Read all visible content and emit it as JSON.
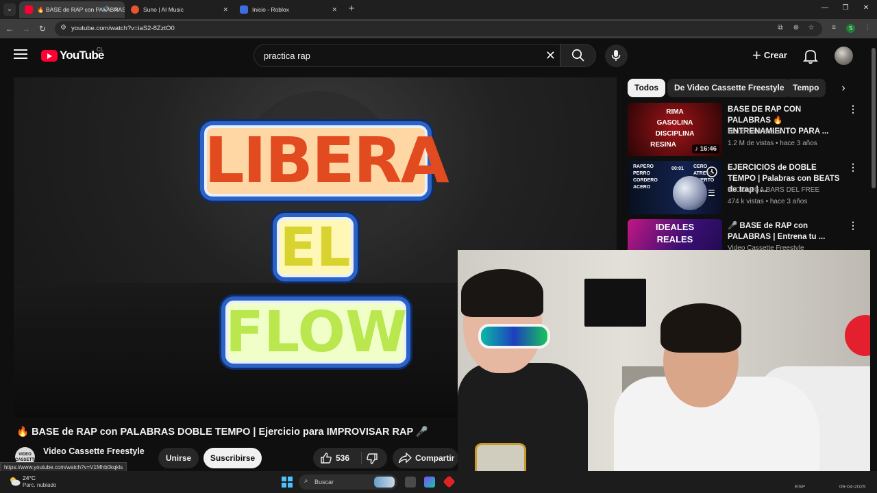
{
  "browser": {
    "tabs": [
      {
        "title": "🔥 BASE de RAP con PALABRAS",
        "active": true,
        "audio": true,
        "icon": "youtube-favicon"
      },
      {
        "title": "Suno | AI Music",
        "active": false,
        "icon": "suno-favicon"
      },
      {
        "title": "Inicio - Roblox",
        "active": false,
        "icon": "roblox-favicon"
      }
    ],
    "url": "youtube.com/watch?v=iaS2-8ZztO0",
    "profile_initial": "S",
    "status_url": "https://www.youtube.com/watch?v=V1Mhb0kqkls"
  },
  "youtube": {
    "logo_text": "YouTube",
    "country_code": "CL",
    "search_value": "practica rap",
    "create_label": "Crear"
  },
  "video": {
    "thumbnail_words": [
      "LIBERA",
      "EL",
      "FLOW"
    ],
    "title": "🔥 BASE de RAP con PALABRAS DOBLE TEMPO | Ejercicio para IMPROVISAR RAP 🎤",
    "channel": "Video Cassette Freestyle",
    "channel_avatar_text": "VIDEO CASSETTE",
    "join_label": "Unirse",
    "subscribe_label": "Suscribirse",
    "likes": "536",
    "share_label": "Compartir"
  },
  "chips": [
    "Todos",
    "De Video Cassette Freestyle",
    "Tempo"
  ],
  "suggestions": [
    {
      "title": "BASE DE RAP CON PALABRAS 🔥 ENTRENAMIENTO PARA ...",
      "channel": "Blood Soul Beats",
      "meta": "1.2 M de vistas • hace 3 años",
      "duration": "♪ 16:46",
      "thumb_words": [
        "RIMA",
        "GASOLINA",
        "DISCIPLINA",
        "RESINA"
      ],
      "thumb_colors": [
        "#7a0c0f",
        "#2a0506"
      ]
    },
    {
      "title": "EJERCICIOS de DOBLE TEMPO | Palabras con BEATS de trap | ...",
      "channel": "El COLEGA BARS DEL FREE",
      "meta": "474 k vistas • hace 3 años",
      "duration": "",
      "thumb_words": [
        "RAPERO PERRO CORDERO ACERO",
        "CERO ATREVO MUERTO"
      ],
      "thumb_timer": "00:01",
      "thumb_colors": [
        "#0b1530",
        "#1f2f66"
      ]
    },
    {
      "title": "🎤 BASE de RAP con PALABRAS | Entrena tu ...",
      "channel": "Video Cassette Freestyle",
      "meta": "",
      "duration": "",
      "thumb_words": [
        "IDEALES",
        "REALES"
      ],
      "thumb_colors": [
        "#c21784",
        "#1b0b4a"
      ]
    }
  ],
  "taskbar": {
    "temperature": "24°C",
    "weather": "Parc. nublado",
    "search_label": "Buscar",
    "lang": "ESP",
    "date": "09-04-2025"
  },
  "colors": {
    "yt_red": "#ff0033",
    "bg": "#0f0f0f",
    "chip_active": "#f1f1f1",
    "chip": "#272727"
  }
}
